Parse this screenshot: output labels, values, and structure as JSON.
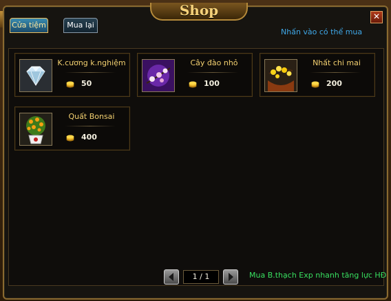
{
  "window": {
    "title": "Shop",
    "close_label": "✕"
  },
  "tabs": [
    {
      "label": "Cửa tiệm",
      "active": true
    },
    {
      "label": "Mua lại",
      "active": false
    }
  ],
  "hint": "Nhấn vào có thể mua",
  "items": [
    {
      "name": "K.cương k.nghiệm",
      "price": "50",
      "icon": "diamond-icon"
    },
    {
      "name": "Cây đào nhỏ",
      "price": "100",
      "icon": "peach-blossom-icon"
    },
    {
      "name": "Nhất chi mai",
      "price": "200",
      "icon": "apricot-blossom-icon"
    },
    {
      "name": "Quất Bonsai",
      "price": "400",
      "icon": "kumquat-bonsai-icon"
    }
  ],
  "pager": {
    "text": "1 / 1"
  },
  "promo": "Mua B.thạch Exp nhanh tăng lực HĐ",
  "colors": {
    "accent_gold": "#f3d070",
    "hint_blue": "#3fa8e8",
    "promo_green": "#38e060"
  }
}
